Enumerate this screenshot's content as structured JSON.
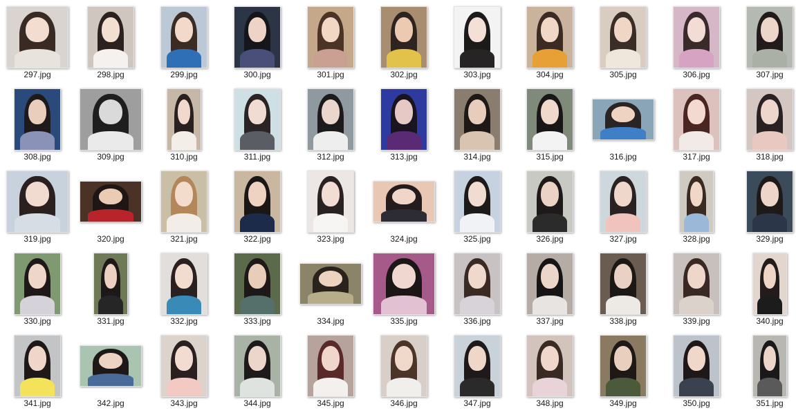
{
  "window": {
    "view": "large-icons"
  },
  "files": [
    {
      "name": "297.jpg",
      "bg": "#d9d4d0",
      "hair": "#3a2a24",
      "skin": "#f2ddd0",
      "cloth": "#e9e3de",
      "shape": "wide"
    },
    {
      "name": "298.jpg",
      "bg": "#cfc7bf",
      "hair": "#2b2220",
      "skin": "#f3dfd2",
      "cloth": "#f4f1ee",
      "shape": "tall"
    },
    {
      "name": "299.jpg",
      "bg": "#bcc8d6",
      "hair": "#3b2b25",
      "skin": "#f3d9c9",
      "cloth": "#2f6fb6",
      "shape": "tall"
    },
    {
      "name": "300.jpg",
      "bg": "#2c3546",
      "hair": "#15161b",
      "skin": "#eed4c6",
      "cloth": "#4a4f7a",
      "shape": "tall"
    },
    {
      "name": "301.jpg",
      "bg": "#c5a88a",
      "hair": "#4b3426",
      "skin": "#f1d7c4",
      "cloth": "#caa092",
      "shape": "tall"
    },
    {
      "name": "302.jpg",
      "bg": "#a88d70",
      "hair": "#2d2420",
      "skin": "#eccab2",
      "cloth": "#e3c24b",
      "shape": "tall"
    },
    {
      "name": "303.jpg",
      "bg": "#f3f3f3",
      "hair": "#1d1a1a",
      "skin": "#f4e0d6",
      "cloth": "#262424",
      "shape": "tall"
    },
    {
      "name": "304.jpg",
      "bg": "#c9b39d",
      "hair": "#3c2b22",
      "skin": "#f1d8c6",
      "cloth": "#e7a035",
      "shape": "tall"
    },
    {
      "name": "305.jpg",
      "bg": "#d8cdc0",
      "hair": "#3a2d27",
      "skin": "#f0d7c5",
      "cloth": "#efe6dc",
      "shape": "tall"
    },
    {
      "name": "306.jpg",
      "bg": "#d6b7c8",
      "hair": "#3b2a2b",
      "skin": "#f3dbd6",
      "cloth": "#d7a3c3",
      "shape": "tall"
    },
    {
      "name": "307.jpg",
      "bg": "#b4b9b2",
      "hair": "#211c1b",
      "skin": "#ecd5c9",
      "cloth": "#aab0a5",
      "shape": "tall"
    },
    {
      "name": "308.jpg",
      "bg": "#294a7a",
      "hair": "#1f1a1a",
      "skin": "#e9cdbd",
      "cloth": "#8a93b7",
      "shape": "tall"
    },
    {
      "name": "309.jpg",
      "bg": "#9e9e9e",
      "hair": "#1e1e1e",
      "skin": "#dadada",
      "cloth": "#eaeaea",
      "shape": "wide"
    },
    {
      "name": "310.jpg",
      "bg": "#c6b7a6",
      "hair": "#2a2020",
      "skin": "#f1d9cd",
      "cloth": "#f4eee8",
      "shape": "slim"
    },
    {
      "name": "311.jpg",
      "bg": "#cfe0e4",
      "hair": "#2b2424",
      "skin": "#f1dcd3",
      "cloth": "#5a5e64",
      "shape": "tall"
    },
    {
      "name": "312.jpg",
      "bg": "#8f9aa0",
      "hair": "#1c1a1a",
      "skin": "#ead6cc",
      "cloth": "#eeeeee",
      "shape": "tall"
    },
    {
      "name": "313.jpg",
      "bg": "#2d3aa0",
      "hair": "#1a1420",
      "skin": "#e6c9c4",
      "cloth": "#5a2a75",
      "shape": "tall"
    },
    {
      "name": "314.jpg",
      "bg": "#8a7c6f",
      "hair": "#1e1816",
      "skin": "#e8cdbd",
      "cloth": "#d8c4b0",
      "shape": "tall"
    },
    {
      "name": "315.jpg",
      "bg": "#7f8a7a",
      "hair": "#181616",
      "skin": "#efd8cc",
      "cloth": "#f3f3f3",
      "shape": "tall"
    },
    {
      "name": "316.jpg",
      "bg": "#8aa5b8",
      "hair": "#2a2424",
      "skin": "#eed3c2",
      "cloth": "#3e7fc8",
      "shape": "landscape"
    },
    {
      "name": "317.jpg",
      "bg": "#dcc1bd",
      "hair": "#4a2622",
      "skin": "#f3d9cf",
      "cloth": "#f1eae6",
      "shape": "tall"
    },
    {
      "name": "318.jpg",
      "bg": "#d4c7c2",
      "hair": "#2a2222",
      "skin": "#efd6cc",
      "cloth": "#e8c8c0",
      "shape": "tall"
    },
    {
      "name": "319.jpg",
      "bg": "#c7d2dc",
      "hair": "#2a2020",
      "skin": "#f1dbd0",
      "cloth": "#d6dde4",
      "shape": "wide"
    },
    {
      "name": "320.jpg",
      "bg": "#4a3326",
      "hair": "#1e1614",
      "skin": "#ebcbb4",
      "cloth": "#b8242a",
      "shape": "landscape"
    },
    {
      "name": "321.jpg",
      "bg": "#c9bfa6",
      "hair": "#b3875a",
      "skin": "#f3dccb",
      "cloth": "#f2ede6",
      "shape": "tall"
    },
    {
      "name": "322.jpg",
      "bg": "#c9b7a2",
      "hair": "#1c1717",
      "skin": "#eed3c3",
      "cloth": "#1d2b4a",
      "shape": "tall"
    },
    {
      "name": "323.jpg",
      "bg": "#ece7e4",
      "hair": "#2a2222",
      "skin": "#f1ddd3",
      "cloth": "#f7f5f3",
      "shape": "tall"
    },
    {
      "name": "324.jpg",
      "bg": "#e8c7b5",
      "hair": "#241c1c",
      "skin": "#f0d6c8",
      "cloth": "#2d2b33",
      "shape": "landscape"
    },
    {
      "name": "325.jpg",
      "bg": "#c6d2df",
      "hair": "#1d1a1a",
      "skin": "#f1dcd2",
      "cloth": "#f1f2f5",
      "shape": "tall"
    },
    {
      "name": "326.jpg",
      "bg": "#c9c9c4",
      "hair": "#1e1a1a",
      "skin": "#ead3c4",
      "cloth": "#2b2b2b",
      "shape": "tall"
    },
    {
      "name": "327.jpg",
      "bg": "#cdd7dc",
      "hair": "#2a2222",
      "skin": "#efd8cb",
      "cloth": "#f0c4bc",
      "shape": "tall"
    },
    {
      "name": "328.jpg",
      "bg": "#cfcac2",
      "hair": "#3a2a22",
      "skin": "#f0d8c8",
      "cloth": "#9ab8d8",
      "shape": "slim"
    },
    {
      "name": "329.jpg",
      "bg": "#3c4b5a",
      "hair": "#1e1a1a",
      "skin": "#edd6c9",
      "cloth": "#2b3748",
      "shape": "tall"
    },
    {
      "name": "330.jpg",
      "bg": "#7f9a70",
      "hair": "#1e1818",
      "skin": "#eed6c8",
      "cloth": "#d6d2da",
      "shape": "tall"
    },
    {
      "name": "331.jpg",
      "bg": "#6e7a55",
      "hair": "#1e1818",
      "skin": "#ecd1c0",
      "cloth": "#262626",
      "shape": "slim"
    },
    {
      "name": "332.jpg",
      "bg": "#e2dedc",
      "hair": "#2a2020",
      "skin": "#f2dcd0",
      "cloth": "#3a8ab8",
      "shape": "tall"
    },
    {
      "name": "333.jpg",
      "bg": "#5a6a4a",
      "hair": "#1e1818",
      "skin": "#e8cdb9",
      "cloth": "#55706a",
      "shape": "tall"
    },
    {
      "name": "334.jpg",
      "bg": "#8c8468",
      "hair": "#2a221c",
      "skin": "#ecd3c0",
      "cloth": "#b6ad8a",
      "shape": "landscape"
    },
    {
      "name": "335.jpg",
      "bg": "#a65a8a",
      "hair": "#1c1616",
      "skin": "#f0d8d0",
      "cloth": "#e2c1d2",
      "shape": "wide"
    },
    {
      "name": "336.jpg",
      "bg": "#c8c2c2",
      "hair": "#3a2a24",
      "skin": "#efd8cc",
      "cloth": "#d7d3d8",
      "shape": "tall"
    },
    {
      "name": "337.jpg",
      "bg": "#b5aca5",
      "hair": "#161414",
      "skin": "#ecd5c9",
      "cloth": "#e8e4e1",
      "shape": "tall"
    },
    {
      "name": "338.jpg",
      "bg": "#6a5c50",
      "hair": "#1c1816",
      "skin": "#e9d1c3",
      "cloth": "#ede9e5",
      "shape": "tall"
    },
    {
      "name": "339.jpg",
      "bg": "#c8c0bc",
      "hair": "#3a2824",
      "skin": "#efd6cb",
      "cloth": "#dcd2cc",
      "shape": "tall"
    },
    {
      "name": "340.jpg",
      "bg": "#e2d6cf",
      "hair": "#241c1c",
      "skin": "#efd5c6",
      "cloth": "#1c1c1c",
      "shape": "slim"
    },
    {
      "name": "341.jpg",
      "bg": "#c2c4c6",
      "hair": "#1e1818",
      "skin": "#efd6c8",
      "cloth": "#f2e35a",
      "shape": "tall"
    },
    {
      "name": "342.jpg",
      "bg": "#a9c4b0",
      "hair": "#1e1818",
      "skin": "#ecd3c3",
      "cloth": "#4a6a9a",
      "shape": "landscape"
    },
    {
      "name": "343.jpg",
      "bg": "#dcd3cd",
      "hair": "#2a2020",
      "skin": "#f2dcd2",
      "cloth": "#f3c9c3",
      "shape": "tall"
    },
    {
      "name": "344.jpg",
      "bg": "#a8b3a5",
      "hair": "#1e1a1a",
      "skin": "#ecd6cb",
      "cloth": "#dfe3e0",
      "shape": "tall"
    },
    {
      "name": "345.jpg",
      "bg": "#b6a49c",
      "hair": "#5a2a2a",
      "skin": "#f0d6cb",
      "cloth": "#f4f0ee",
      "shape": "tall"
    },
    {
      "name": "346.jpg",
      "bg": "#d8cfc9",
      "hair": "#4b3428",
      "skin": "#f0d8cb",
      "cloth": "#f1efeb",
      "shape": "tall"
    },
    {
      "name": "347.jpg",
      "bg": "#c8d2d8",
      "hair": "#1e1a1a",
      "skin": "#eed6c9",
      "cloth": "#2a2a2a",
      "shape": "tall"
    },
    {
      "name": "348.jpg",
      "bg": "#d3c3bd",
      "hair": "#3a2a24",
      "skin": "#efd7cb",
      "cloth": "#e8d4d8",
      "shape": "tall"
    },
    {
      "name": "349.jpg",
      "bg": "#8a7a62",
      "hair": "#1e1816",
      "skin": "#e9cfbd",
      "cloth": "#4a5a3a",
      "shape": "tall"
    },
    {
      "name": "350.jpg",
      "bg": "#bcc3ca",
      "hair": "#1e1818",
      "skin": "#efd7ca",
      "cloth": "#3a4250",
      "shape": "tall"
    },
    {
      "name": "351.jpg",
      "bg": "#b9b7b2",
      "hair": "#1a1818",
      "skin": "#ecd6ca",
      "cloth": "#5a5a5a",
      "shape": "slim"
    }
  ]
}
